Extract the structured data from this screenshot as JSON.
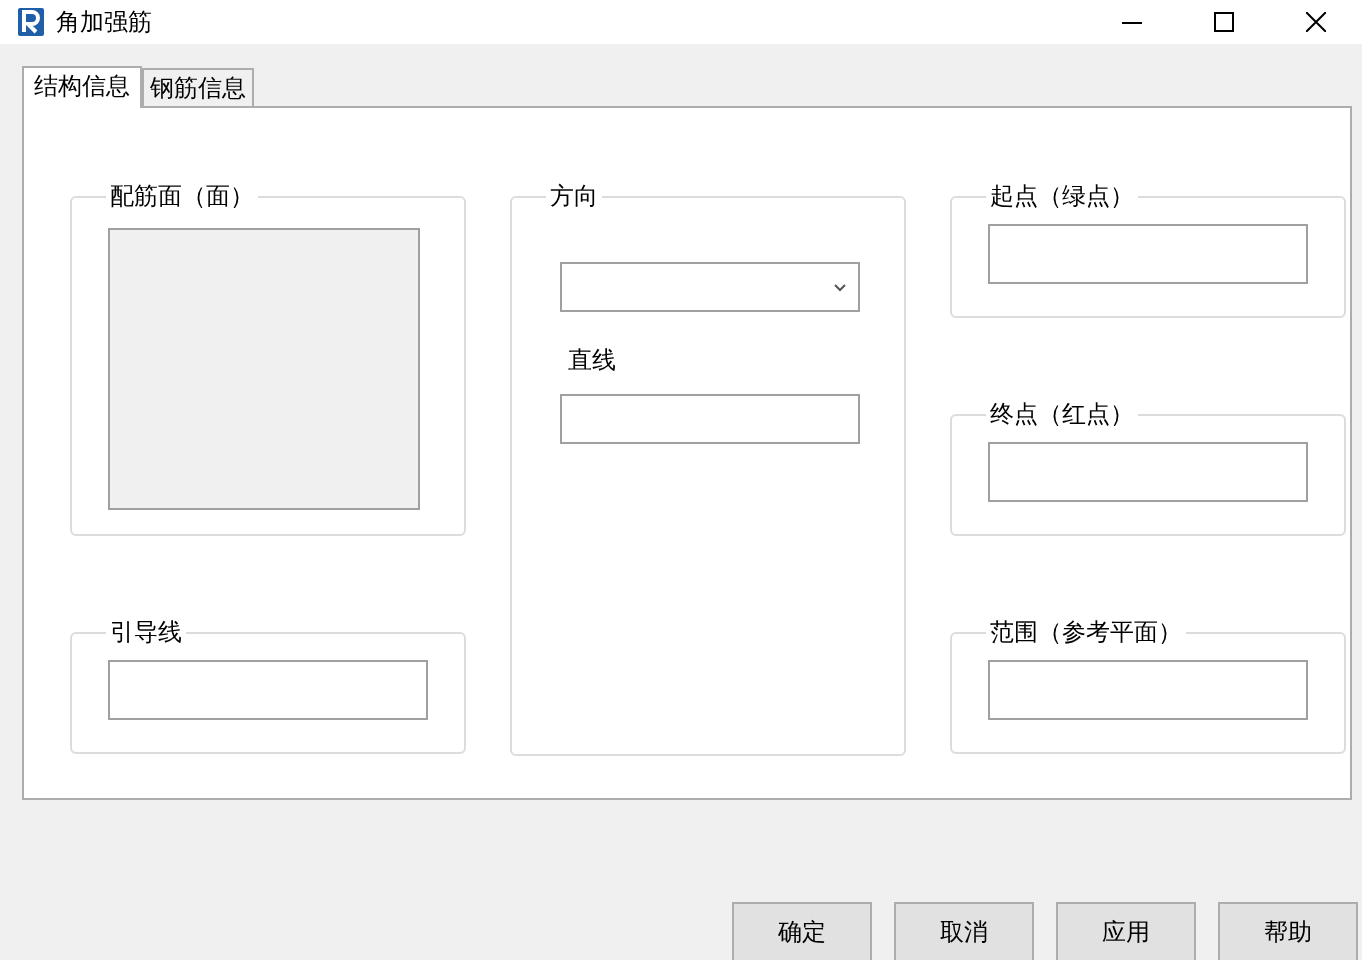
{
  "window": {
    "title": "角加强筋"
  },
  "tabs": [
    {
      "label": "结构信息",
      "selected": true
    },
    {
      "label": "钢筋信息",
      "selected": false
    }
  ],
  "columns": [
    [
      {
        "kind": "preview",
        "title": "配筋面（面）"
      },
      {
        "kind": "field",
        "title": "引导线"
      }
    ],
    [
      {
        "kind": "direction",
        "title": "方向",
        "sublabel": "直线"
      }
    ],
    [
      {
        "kind": "field",
        "title": "起点（绿点）"
      },
      {
        "kind": "field",
        "title": "终点（红点）"
      },
      {
        "kind": "field",
        "title": "范围（参考平面）"
      }
    ]
  ],
  "buttons": [
    "确定",
    "取消",
    "应用",
    "帮助"
  ]
}
